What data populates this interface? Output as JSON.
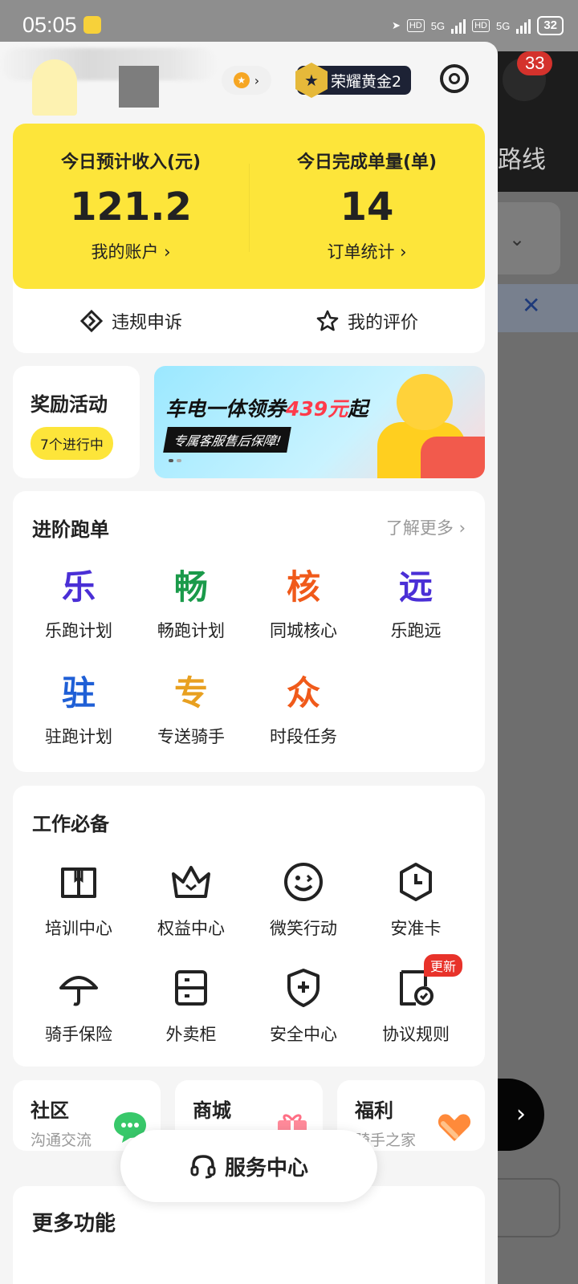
{
  "status_bar": {
    "time": "05:05",
    "hd1": "HD",
    "net1": "5G",
    "hd2": "HD",
    "net2": "5G",
    "battery": "32"
  },
  "background": {
    "notification_count": "33",
    "route_text": "路线"
  },
  "profile": {
    "level_badge": "荣耀黄金2"
  },
  "earnings": {
    "income_label": "今日预计收入(元)",
    "income_value": "121.2",
    "account_link": "我的账户 ›",
    "orders_label": "今日完成单量(单)",
    "orders_value": "14",
    "orders_link": "订单统计 ›",
    "appeal_label": "违规申诉",
    "rating_label": "我的评价"
  },
  "rewards": {
    "title": "奖励活动",
    "ongoing": "7个进行中"
  },
  "banner": {
    "line1_prefix": "车电一体领券",
    "line1_amount": "439元",
    "line1_suffix": "起",
    "line2": "专属客服售后保障!"
  },
  "advanced": {
    "title": "进阶跑单",
    "more": "了解更多 ›",
    "items": [
      {
        "glyph": "乐",
        "label": "乐跑计划",
        "color": "#4a2fd6"
      },
      {
        "glyph": "畅",
        "label": "畅跑计划",
        "color": "#1a9a4a"
      },
      {
        "glyph": "核",
        "label": "同城核心",
        "color": "#f05a1a"
      },
      {
        "glyph": "远",
        "label": "乐跑远",
        "color": "#4a2fd6"
      },
      {
        "glyph": "驻",
        "label": "驻跑计划",
        "color": "#1f5fd6"
      },
      {
        "glyph": "专",
        "label": "专送骑手",
        "color": "#e8a020"
      },
      {
        "glyph": "众",
        "label": "时段任务",
        "color": "#f05a1a"
      }
    ]
  },
  "essentials": {
    "title": "工作必备",
    "items": [
      {
        "icon": "book-icon",
        "label": "培训中心"
      },
      {
        "icon": "crown-icon",
        "label": "权益中心"
      },
      {
        "icon": "smile-icon",
        "label": "微笑行动"
      },
      {
        "icon": "clock-shield-icon",
        "label": "安准卡"
      },
      {
        "icon": "umbrella-icon",
        "label": "骑手保险"
      },
      {
        "icon": "locker-icon",
        "label": "外卖柜"
      },
      {
        "icon": "shield-plus-icon",
        "label": "安全中心"
      },
      {
        "icon": "document-check-icon",
        "label": "协议规则",
        "tag": "更新"
      }
    ]
  },
  "tiles": [
    {
      "title": "社区",
      "subtitle": "沟通交流",
      "icon": "chat-icon"
    },
    {
      "title": "商城",
      "subtitle": "",
      "icon": "gift-icon"
    },
    {
      "title": "福利",
      "subtitle": "骑手之家",
      "icon": "heart-icon"
    }
  ],
  "service_center": {
    "label": "服务中心"
  },
  "more_functions": {
    "title": "更多功能"
  }
}
